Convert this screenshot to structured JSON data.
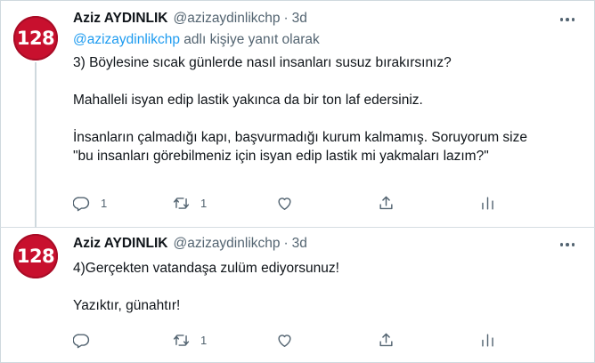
{
  "tweets": [
    {
      "avatar_text": "128",
      "name": "Aziz AYDINLIK",
      "handle": "@azizaydinlikchp",
      "separator": "·",
      "time": "3d",
      "reply_mention": "@azizaydinlikchp",
      "reply_suffix": " adlı kişiye yanıt olarak",
      "lines": [
        "3) Böylesine sıcak günlerde nasıl insanları susuz bırakırsınız?",
        "",
        "Mahalleli isyan edip lastik yakınca da bir ton laf edersiniz.",
        "",
        "İnsanların çalmadığı kapı, başvurmadığı kurum kalmamış. Soruyorum size",
        "\"bu insanları görebilmeniz için isyan edip lastik mi yakmaları lazım?\""
      ],
      "reply_count": "1",
      "retweet_count": "1",
      "like_count": "",
      "icons": [
        "reply-icon",
        "retweet-icon",
        "like-icon",
        "share-icon",
        "analytics-icon",
        "more-icon"
      ]
    },
    {
      "avatar_text": "128",
      "name": "Aziz AYDINLIK",
      "handle": "@azizaydinlikchp",
      "separator": "·",
      "time": "3d",
      "lines": [
        "4)Gerçekten vatandaşa zulüm ediyorsunuz!",
        "",
        "Yazıktır, günahtır!"
      ],
      "reply_count": "",
      "retweet_count": "1",
      "like_count": ""
    }
  ],
  "colors": {
    "text": "#0f1419",
    "muted": "#536471",
    "link": "#1d9bf0",
    "avatar_bg": "#c8102e",
    "border": "#cfd9de"
  }
}
